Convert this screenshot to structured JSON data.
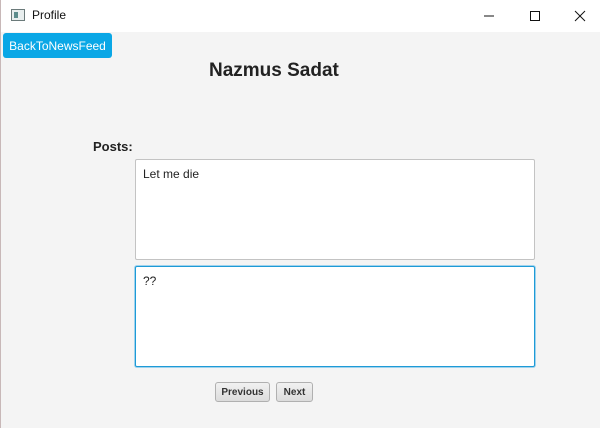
{
  "window": {
    "title": "Profile",
    "icons": {
      "app": "window-app-icon",
      "minimize": "minimize-icon",
      "maximize": "maximize-icon",
      "close": "close-icon"
    }
  },
  "toolbar": {
    "back_label": "BackToNewsFeed"
  },
  "profile": {
    "name": "Nazmus Sadat"
  },
  "posts": {
    "label": "Posts:",
    "items": [
      {
        "text": "Let me die"
      },
      {
        "text": "??"
      }
    ]
  },
  "pagination": {
    "previous_label": "Previous",
    "next_label": "Next"
  },
  "colors": {
    "accent": "#0aa7e6",
    "focus_border": "#1e9ad6"
  }
}
